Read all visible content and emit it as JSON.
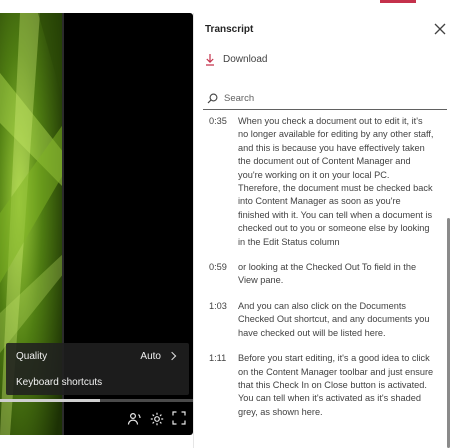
{
  "video": {
    "menu": [
      {
        "label": "Quality",
        "value": "Auto"
      },
      {
        "label": "Keyboard shortcuts",
        "value": ""
      }
    ],
    "progress_fraction": 0.52
  },
  "transcript": {
    "title": "Transcript",
    "download_label": "Download",
    "search_placeholder": "Search",
    "entries": [
      {
        "time": "0:35",
        "text": "When you check a document out to edit it, it's no longer available for editing by any other staff, and this is because you have effectively taken the document out of Content Manager and you're working on it on your local PC. Therefore, the document must be checked back into Content Manager as soon as you're finished with it. You can tell when a document is checked out to you or someone else by looking in the Edit Status column"
      },
      {
        "time": "0:59",
        "text": "or looking at the Checked Out To field in the View pane."
      },
      {
        "time": "1:03",
        "text": "And you can also click on the Documents Checked Out shortcut, and any documents you have checked out will be listed here."
      },
      {
        "time": "1:11",
        "text": "Before you start editing, it's a good idea to click on the Content Manager toolbar and just ensure that this Check In on Close button is activated. You can tell when it's activated as it's shaded grey, as shown here."
      }
    ]
  },
  "colors": {
    "accent": "#c4314b",
    "panel_bg": "#ffffff",
    "video_bg": "#000000"
  }
}
